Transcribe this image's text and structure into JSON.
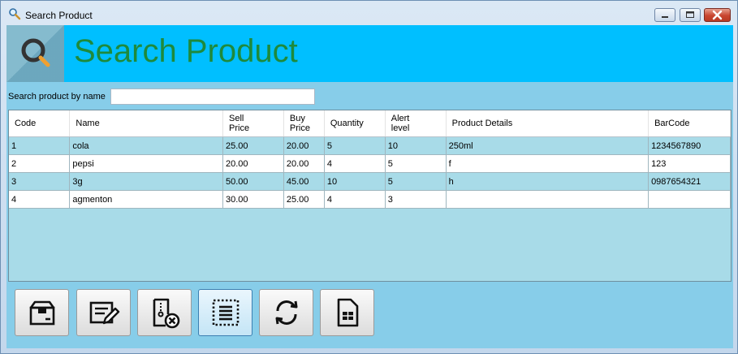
{
  "window": {
    "title": "Search Product",
    "controls": [
      "minimize-icon",
      "maximize-icon",
      "close-icon"
    ]
  },
  "header": {
    "title": "Search Product",
    "logo_icon": "magnifier-icon",
    "title_color": "#1e8a3c",
    "background": "#00bfff"
  },
  "search": {
    "label": "Search product by name",
    "value": "",
    "placeholder": ""
  },
  "table": {
    "columns": [
      {
        "label": "Code"
      },
      {
        "label": "Name"
      },
      {
        "label": "Sell\nPrice"
      },
      {
        "label": "Buy\nPrice"
      },
      {
        "label": "Quantity"
      },
      {
        "label": "Alert\nlevel"
      },
      {
        "label": "Product Details"
      },
      {
        "label": "BarCode"
      }
    ],
    "rows": [
      [
        "1",
        "cola",
        "25.00",
        "20.00",
        "5",
        "10",
        "250ml",
        "1234567890"
      ],
      [
        "2",
        "pepsi",
        "20.00",
        "20.00",
        "4",
        "5",
        "f",
        "123"
      ],
      [
        "3",
        "3g",
        "50.00",
        "45.00",
        "10",
        "5",
        "h",
        "0987654321"
      ],
      [
        "4",
        "agmenton",
        "30.00",
        "25.00",
        "4",
        "3",
        "",
        ""
      ]
    ]
  },
  "toolbar": {
    "buttons": [
      {
        "icon": "product-box-icon"
      },
      {
        "icon": "edit-document-icon"
      },
      {
        "icon": "delete-document-icon"
      },
      {
        "icon": "select-all-icon"
      },
      {
        "icon": "refresh-icon"
      },
      {
        "icon": "report-document-icon"
      }
    ]
  }
}
